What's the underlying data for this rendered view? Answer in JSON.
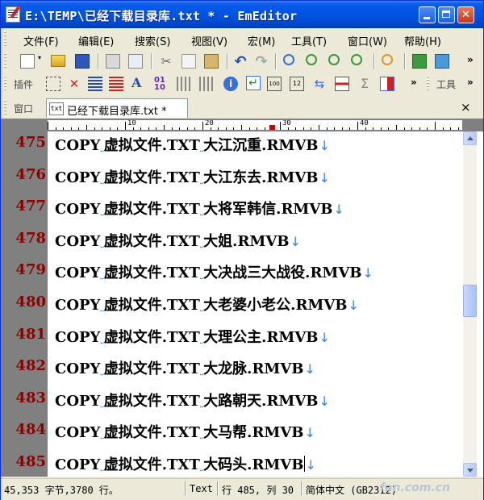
{
  "window": {
    "title": "E:\\TEMP\\已经下载目录库.txt * - EmEditor"
  },
  "menu": [
    "文件(F)",
    "编辑(E)",
    "搜索(S)",
    "视图(V)",
    "宏(M)",
    "工具(T)",
    "窗口(W)",
    "帮助(H)"
  ],
  "toolbar2": {
    "plugins_label": "插件",
    "tools_label": "工具"
  },
  "tabbar": {
    "window_label": "窗口",
    "tab_icon": "txt",
    "tab_label": "已经下载目录库.txt *",
    "close": "×"
  },
  "ruler": {
    "marks": [
      "10",
      "20",
      "30",
      "40"
    ]
  },
  "editor": {
    "lines": [
      {
        "num": "475",
        "prefix": "COPY",
        "text": "虚拟文件.TXT",
        "name": "大江沉重.RMVB"
      },
      {
        "num": "476",
        "prefix": "COPY",
        "text": "虚拟文件.TXT",
        "name": "大江东去.RMVB"
      },
      {
        "num": "477",
        "prefix": "COPY",
        "text": "虚拟文件.TXT",
        "name": "大将军韩信.RMVB"
      },
      {
        "num": "478",
        "prefix": "COPY",
        "text": "虚拟文件.TXT",
        "name": "大姐.RMVB"
      },
      {
        "num": "479",
        "prefix": "COPY",
        "text": "虚拟文件.TXT",
        "name": "大决战三大战役.RMVB"
      },
      {
        "num": "480",
        "prefix": "COPY",
        "text": "虚拟文件.TXT",
        "name": "大老婆小老公.RMVB"
      },
      {
        "num": "481",
        "prefix": "COPY",
        "text": "虚拟文件.TXT",
        "name": "大理公主.RMVB"
      },
      {
        "num": "482",
        "prefix": "COPY",
        "text": "虚拟文件.TXT",
        "name": "大龙脉.RMVB"
      },
      {
        "num": "483",
        "prefix": "COPY",
        "text": "虚拟文件.TXT",
        "name": "大路朝天.RMVB"
      },
      {
        "num": "484",
        "prefix": "COPY",
        "text": "虚拟文件.TXT",
        "name": "大马帮.RMVB"
      },
      {
        "num": "485",
        "prefix": "COPY",
        "text": "虚拟文件.TXT",
        "name": "大码头.RMVB"
      }
    ],
    "space_mark": "˽",
    "eol_mark": "↓"
  },
  "status": {
    "size": "45,353 字节,3780 行。",
    "mode": "Text",
    "position": "行 485, 列 30",
    "encoding": "简体中文 (GB2312)"
  },
  "watermark": "fan.com.cn",
  "colors": {
    "titlebar": "#0054E3",
    "line_numbers": "#8B0000",
    "whitespace_marks": "#3B7FD6"
  }
}
